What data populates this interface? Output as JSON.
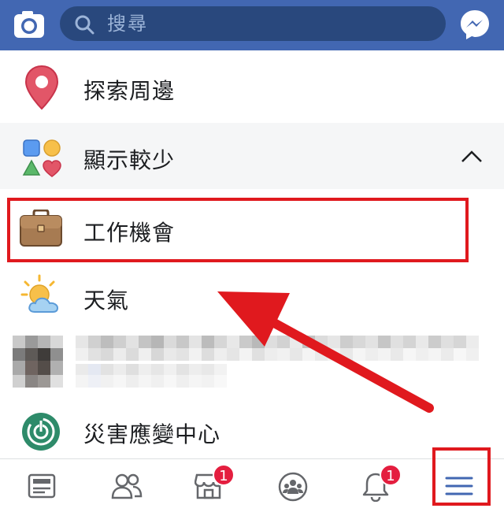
{
  "topbar": {
    "search_placeholder": "搜尋"
  },
  "menu": {
    "explore_label": "探索周邊",
    "less_label": "顯示較少",
    "jobs_label": "工作機會",
    "weather_label": "天氣",
    "crisis_label": "災害應變中心"
  },
  "tabs": {
    "marketplace_badge": "1",
    "notifications_badge": "1"
  },
  "colors": {
    "brand": "#4267b2",
    "highlight": "#e0191e",
    "badge": "#e41e3f",
    "active_tab": "#4267b2"
  }
}
